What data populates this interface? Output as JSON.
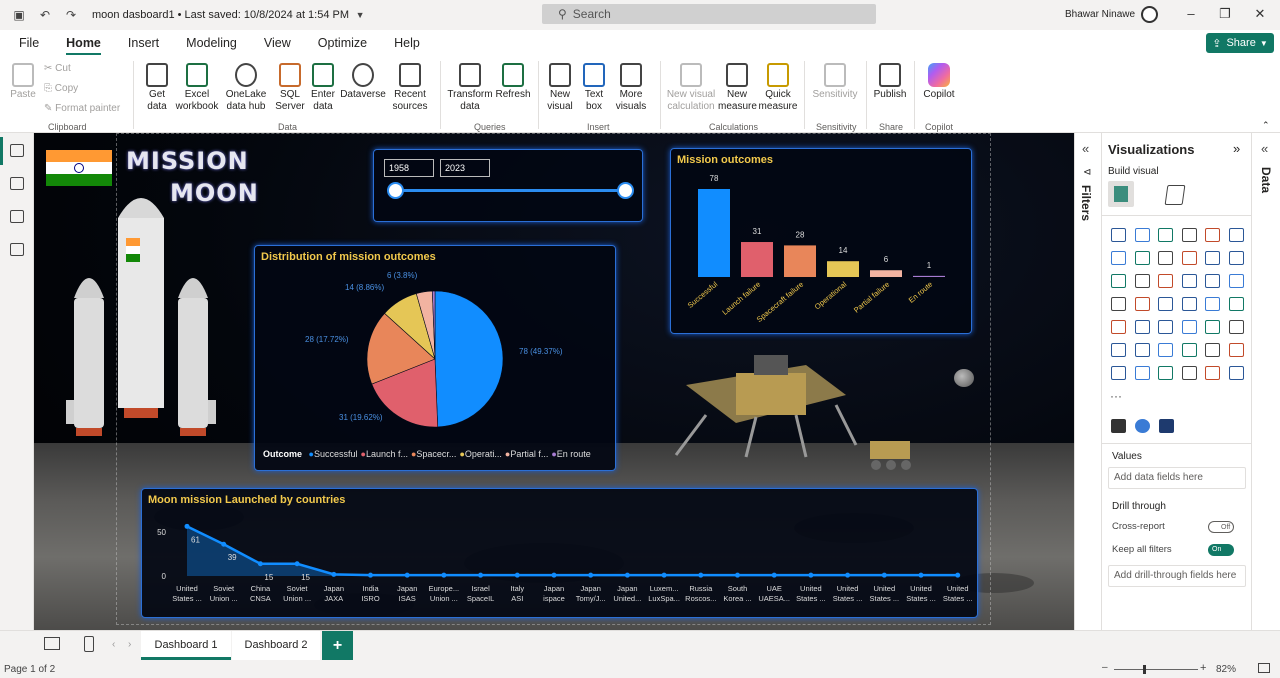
{
  "titlebar": {
    "doc_title": "moon dasboard1  •  Last saved: 10/8/2024 at 1:54 PM",
    "search_placeholder": "Search",
    "user_name": "Bhawar Ninawe"
  },
  "menu": {
    "items": [
      "File",
      "Home",
      "Insert",
      "Modeling",
      "View",
      "Optimize",
      "Help"
    ],
    "active": "Home",
    "share_label": "Share"
  },
  "ribbon": {
    "clipboard": {
      "paste": "Paste",
      "cut": "Cut",
      "copy": "Copy",
      "format_painter": "Format painter",
      "group": "Clipboard"
    },
    "data": {
      "get_data": "Get data",
      "excel": "Excel workbook",
      "onelake": "OneLake data hub",
      "sql": "SQL Server",
      "enter": "Enter data",
      "dataverse": "Dataverse",
      "recent": "Recent sources",
      "group": "Data"
    },
    "queries": {
      "transform": "Transform data",
      "refresh": "Refresh",
      "group": "Queries"
    },
    "insert": {
      "new_visual": "New visual",
      "text_box": "Text box",
      "more_visuals": "More visuals",
      "group": "Insert"
    },
    "calculations": {
      "new_visual_calc": "New visual calculation",
      "new_measure": "New measure",
      "quick_measure": "Quick measure",
      "group": "Calculations"
    },
    "sensitivity": {
      "label": "Sensitivity",
      "group": "Sensitivity"
    },
    "share": {
      "publish": "Publish",
      "group": "Share"
    },
    "copilot": {
      "label": "Copilot",
      "group": "Copilot"
    }
  },
  "report": {
    "title_line1": "MISSION",
    "title_line2": "MOON",
    "slider": {
      "start": "1958",
      "end": "2023"
    },
    "pie_title": "Distribution of mission outcomes",
    "bar_title": "Mission outcomes",
    "line_title": "Moon mission Launched by countries",
    "legend_title": "Outcome",
    "legend": [
      "Successful",
      "Launch f...",
      "Spacecr...",
      "Operati...",
      "Partial f...",
      "En route"
    ]
  },
  "chart_data": [
    {
      "type": "pie",
      "title": "Distribution of mission outcomes",
      "categories": [
        "Successful",
        "Launch failure",
        "Spacecraft failure",
        "Operational",
        "Partial failure",
        "En route"
      ],
      "values": [
        78,
        31,
        28,
        14,
        6,
        1
      ],
      "labels": [
        "78 (49.37%)",
        "31 (19.62%)",
        "28 (17.72%)",
        "14 (8.86%)",
        "6 (3.8%)",
        ""
      ],
      "colors": [
        "#118dff",
        "#e0606c",
        "#e8865a",
        "#e5c656",
        "#f2b3a1",
        "#a77bd1"
      ]
    },
    {
      "type": "bar",
      "title": "Mission outcomes",
      "categories": [
        "Successful",
        "Launch failure",
        "Spacecraft failure",
        "Operational",
        "Partial failure",
        "En route"
      ],
      "values": [
        78,
        31,
        28,
        14,
        6,
        1
      ],
      "colors": [
        "#118dff",
        "#e0606c",
        "#e8865a",
        "#e5c656",
        "#f2b3a1",
        "#a77bd1"
      ]
    },
    {
      "type": "area",
      "title": "Moon mission Launched by countries",
      "categories": [
        "United States ...",
        "Soviet Union ...",
        "China CNSA",
        "Soviet Union ...",
        "Japan JAXA",
        "India ISRO",
        "Japan ISAS",
        "Europe... Union ...",
        "Israel SpaceIL",
        "Italy ASI",
        "Japan ispace",
        "Japan Tomy/J...",
        "Japan United...",
        "Luxem... LuxSpa...",
        "Russia Roscos...",
        "South Korea ...",
        "UAE UAESA...",
        "United States ...",
        "United States ...",
        "United States ...",
        "United States ...",
        "United States ..."
      ],
      "values": [
        61,
        39,
        15,
        15,
        2,
        1,
        1,
        1,
        1,
        1,
        1,
        1,
        1,
        1,
        1,
        1,
        1,
        1,
        1,
        1,
        1,
        1
      ],
      "data_labels": [
        "61",
        "39",
        "15",
        "15"
      ],
      "y_ticks": [
        "50",
        "0"
      ],
      "ylim": [
        0,
        70
      ],
      "color": "#118dff"
    }
  ],
  "filters_label": "Filters",
  "data_label": "Data",
  "viz_pane": {
    "title": "Visualizations",
    "build_visual": "Build visual",
    "more": "···",
    "values_label": "Values",
    "values_placeholder": "Add data fields here",
    "drill_through": "Drill through",
    "cross_report": "Cross-report",
    "cross_report_state": "Off",
    "keep_filters": "Keep all filters",
    "keep_filters_state": "On",
    "drill_placeholder": "Add drill-through fields here"
  },
  "tabs": [
    "Dashboard 1",
    "Dashboard 2"
  ],
  "add_tab": "+",
  "status": {
    "page": "Page 1 of 2",
    "zoom": "82%"
  }
}
